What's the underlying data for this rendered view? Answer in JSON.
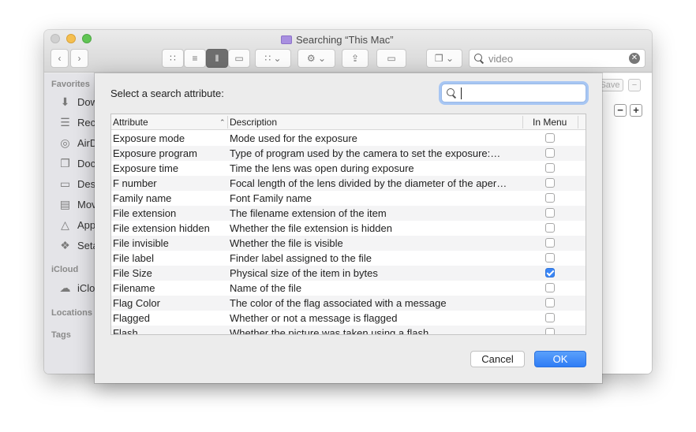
{
  "window": {
    "title": "Searching “This Mac”",
    "search_value": "video",
    "save_label": "Save"
  },
  "sidebar": {
    "favorites_header": "Favorites",
    "favorites": [
      {
        "label": "Dow",
        "icon": "download-icon"
      },
      {
        "label": "Rec",
        "icon": "recents-icon"
      },
      {
        "label": "AirD",
        "icon": "airdrop-icon"
      },
      {
        "label": "Doc",
        "icon": "documents-icon"
      },
      {
        "label": "Des",
        "icon": "desktop-icon"
      },
      {
        "label": "Mov",
        "icon": "movies-icon"
      },
      {
        "label": "App",
        "icon": "applications-icon"
      },
      {
        "label": "Seta",
        "icon": "setapp-icon"
      }
    ],
    "icloud_header": "iCloud",
    "icloud_item": "iClo",
    "locations_header": "Locations",
    "tags_header": "Tags"
  },
  "dialog": {
    "prompt": "Select a search attribute:",
    "search_value": "",
    "columns": {
      "attribute": "Attribute",
      "description": "Description",
      "in_menu": "In Menu"
    },
    "rows": [
      {
        "attribute": "Exposure mode",
        "description": "Mode used for the exposure",
        "in_menu": false
      },
      {
        "attribute": "Exposure program",
        "description": "Type of program used by the camera to set the exposure:…",
        "in_menu": false
      },
      {
        "attribute": "Exposure time",
        "description": "Time the lens was open during exposure",
        "in_menu": false
      },
      {
        "attribute": "F number",
        "description": "Focal length of the lens divided by the diameter of the aper…",
        "in_menu": false
      },
      {
        "attribute": "Family name",
        "description": "Font Family name",
        "in_menu": false
      },
      {
        "attribute": "File extension",
        "description": "The filename extension of the item",
        "in_menu": false
      },
      {
        "attribute": "File extension hidden",
        "description": "Whether the file extension is hidden",
        "in_menu": false
      },
      {
        "attribute": "File invisible",
        "description": "Whether the file is visible",
        "in_menu": false
      },
      {
        "attribute": "File label",
        "description": "Finder label assigned to the file",
        "in_menu": false
      },
      {
        "attribute": "File Size",
        "description": "Physical size of the item in bytes",
        "in_menu": true
      },
      {
        "attribute": "Filename",
        "description": "Name of the file",
        "in_menu": false
      },
      {
        "attribute": "Flag Color",
        "description": "The color of the flag associated with a message",
        "in_menu": false
      },
      {
        "attribute": "Flagged",
        "description": "Whether or not a message is flagged",
        "in_menu": false
      },
      {
        "attribute": "Flash",
        "description": "Whether the picture was taken using a flash",
        "in_menu": false
      }
    ],
    "cancel_label": "Cancel",
    "ok_label": "OK"
  },
  "colors": {
    "accent": "#2f7df5",
    "checkbox_on": "#3a86f7"
  }
}
